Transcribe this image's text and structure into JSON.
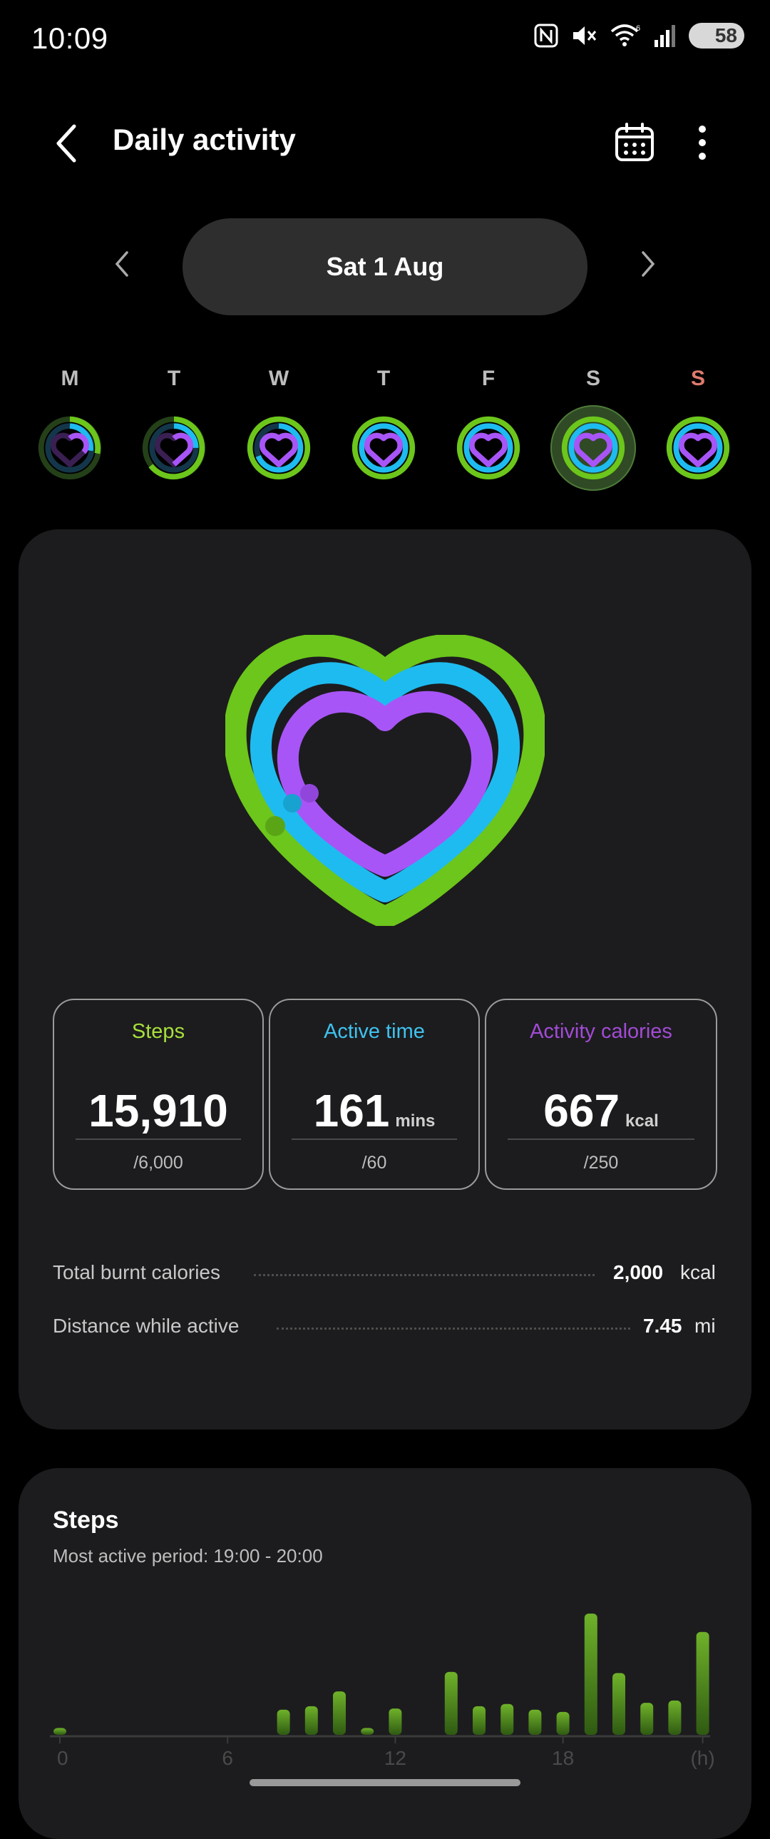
{
  "status_bar": {
    "time": "10:09",
    "battery": "58",
    "icons": [
      "nfc-icon",
      "mute-icon",
      "wifi-icon",
      "signal-icon",
      "battery-icon"
    ]
  },
  "header": {
    "title": "Daily activity",
    "icons": [
      "back-arrow-icon",
      "calendar-icon",
      "more-vert-icon"
    ]
  },
  "date_nav": {
    "label": "Sat 1 Aug"
  },
  "week": {
    "days": [
      {
        "letter": "M",
        "selected": false
      },
      {
        "letter": "T",
        "selected": false
      },
      {
        "letter": "W",
        "selected": false
      },
      {
        "letter": "T",
        "selected": false
      },
      {
        "letter": "F",
        "selected": false
      },
      {
        "letter": "S",
        "selected": true
      },
      {
        "letter": "S",
        "selected": false
      }
    ]
  },
  "colors": {
    "steps": "#a8e03a",
    "active_time": "#3fc2f0",
    "calories": "#a24bd6",
    "ring_green": "#6cc61b",
    "ring_blue": "#1ebbf0",
    "ring_purple": "#a855f7",
    "sunday": "#e07a6e"
  },
  "stats": {
    "steps": {
      "label": "Steps",
      "value": "15,910",
      "unit": "",
      "goal": "/6,000"
    },
    "active_time": {
      "label": "Active time",
      "value": "161",
      "unit": "mins",
      "goal": "/60"
    },
    "calories": {
      "label": "Activity calories",
      "value": "667",
      "unit": "kcal",
      "goal": "/250"
    }
  },
  "summary": {
    "total_burnt": {
      "label": "Total burnt calories",
      "value": "2,000",
      "unit": "kcal"
    },
    "distance": {
      "label": "Distance while active",
      "value": "7.45",
      "unit": "mi"
    }
  },
  "steps_chart": {
    "title": "Steps",
    "subtitle": "Most active period: 19:00 - 20:00"
  },
  "chart_data": {
    "type": "bar",
    "x_ticks": [
      "0",
      "6",
      "12",
      "18",
      "(h)"
    ],
    "categories": [
      0,
      1,
      2,
      3,
      4,
      5,
      6,
      7,
      8,
      9,
      10,
      11,
      12,
      13,
      14,
      15,
      16,
      17,
      18,
      19,
      20,
      21,
      22,
      23
    ],
    "values": [
      60,
      0,
      0,
      0,
      0,
      0,
      0,
      0,
      220,
      250,
      380,
      60,
      230,
      0,
      550,
      250,
      270,
      220,
      200,
      1060,
      540,
      280,
      300,
      900
    ]
  }
}
